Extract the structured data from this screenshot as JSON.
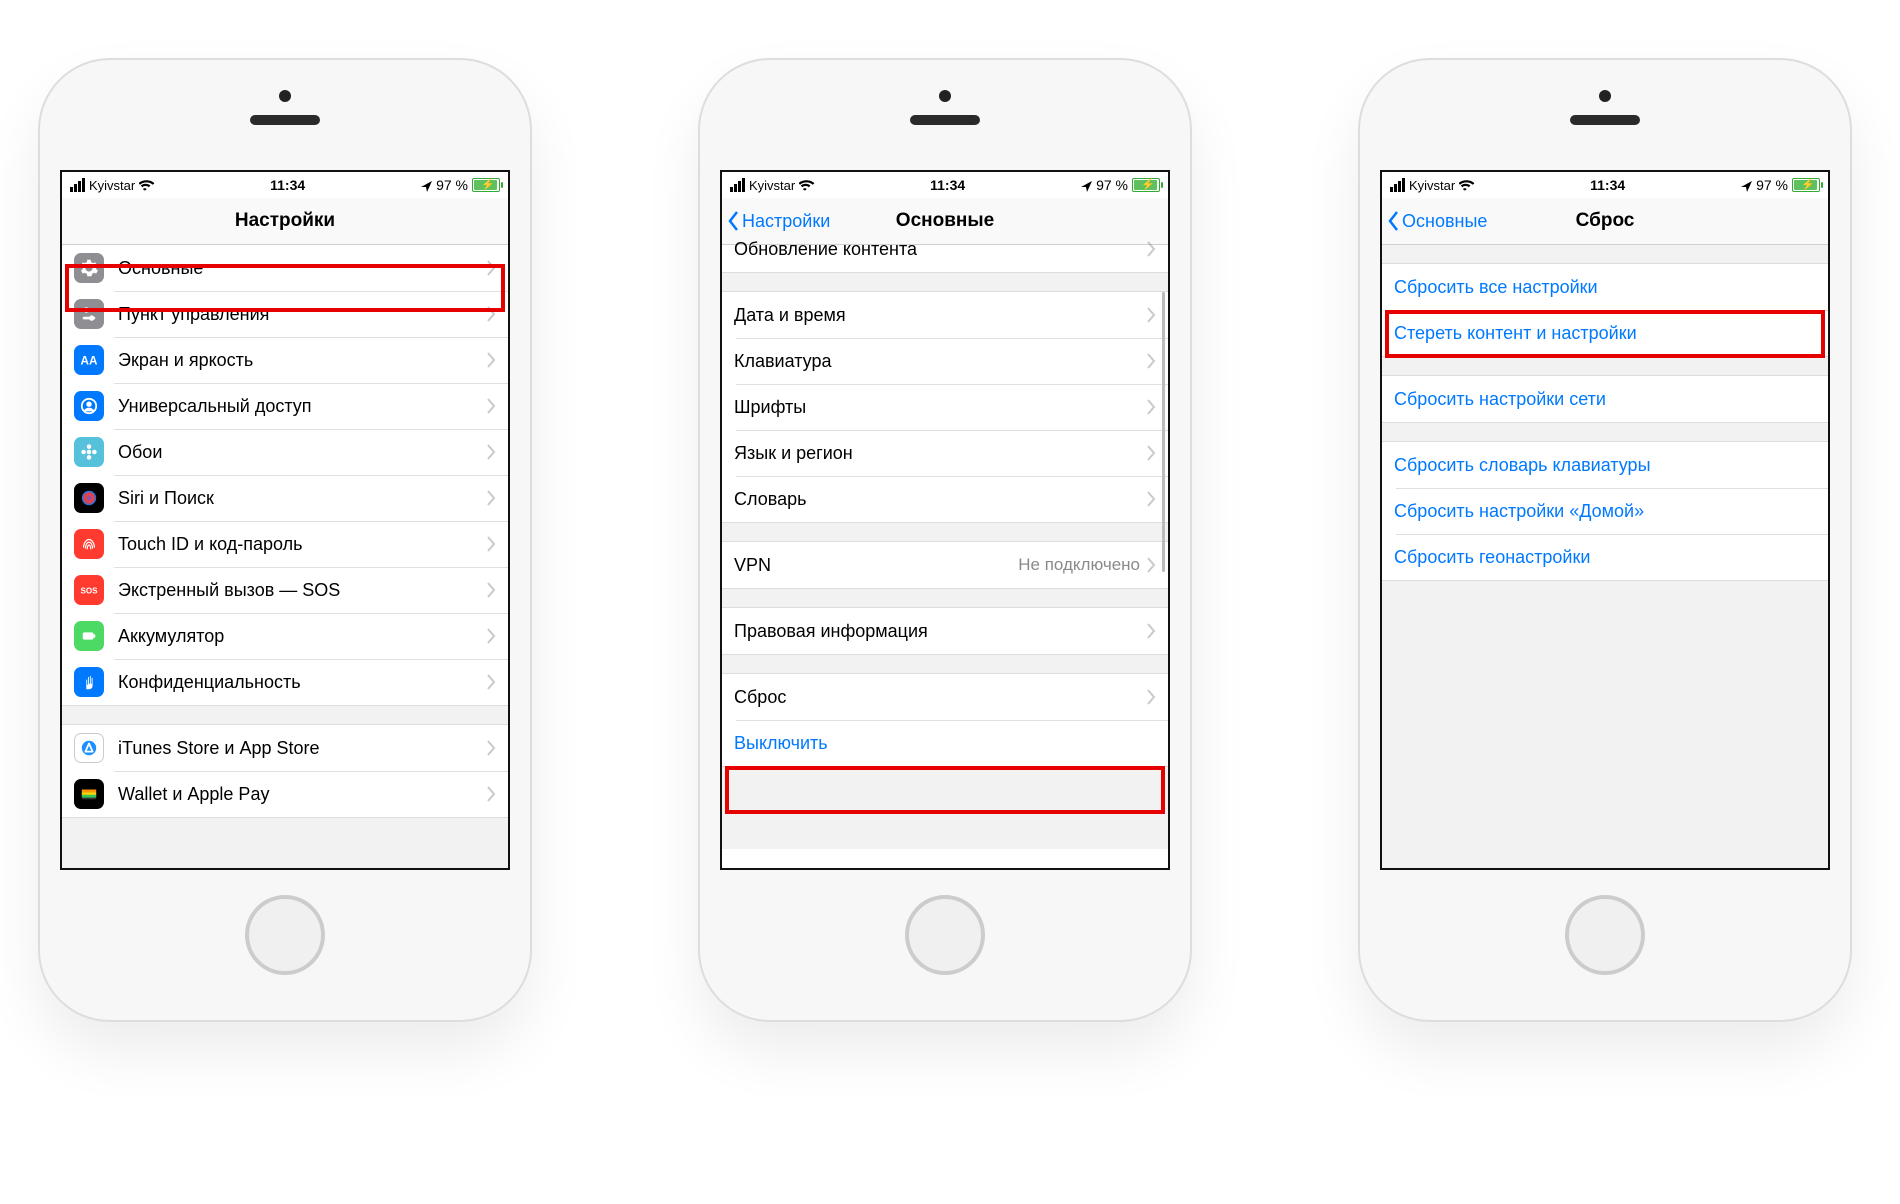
{
  "status": {
    "carrier": "Kyivstar",
    "time": "11:34",
    "battery": "97 %"
  },
  "phone1": {
    "title": "Настройки",
    "rows": [
      {
        "label": "Основные",
        "icon": "gear",
        "bg": "#8e8e93",
        "tint": "#fff"
      },
      {
        "label": "Пункт управления",
        "icon": "sliders",
        "bg": "#8e8e93",
        "tint": "#fff"
      },
      {
        "label": "Экран и яркость",
        "icon": "aa",
        "bg": "#0079ff",
        "tint": "#fff"
      },
      {
        "label": "Универсальный доступ",
        "icon": "person",
        "bg": "#0079ff",
        "tint": "#fff"
      },
      {
        "label": "Обои",
        "icon": "flower",
        "bg": "#55c1da",
        "tint": "#fff"
      },
      {
        "label": "Siri и Поиск",
        "icon": "siri",
        "bg": "#000",
        "tint": "#fff"
      },
      {
        "label": "Touch ID и код-пароль",
        "icon": "finger",
        "bg": "#ff3b30",
        "tint": "#fff"
      },
      {
        "label": "Экстренный вызов — SOS",
        "icon": "sos",
        "bg": "#ff3b30",
        "tint": "#fff"
      },
      {
        "label": "Аккумулятор",
        "icon": "batt",
        "bg": "#4cd964",
        "tint": "#fff"
      },
      {
        "label": "Конфиденциальность",
        "icon": "hand",
        "bg": "#0079ff",
        "tint": "#fff"
      }
    ],
    "rows2": [
      {
        "label": "iTunes Store и App Store",
        "icon": "appstore",
        "bg": "#fff",
        "tint": "#1e90ff",
        "border": true
      },
      {
        "label": "Wallet и Apple Pay",
        "icon": "wallet",
        "bg": "#000",
        "tint": "#fff"
      }
    ]
  },
  "phone2": {
    "back": "Настройки",
    "title": "Основные",
    "g1": [
      {
        "label": "Обновление контента"
      }
    ],
    "g2": [
      {
        "label": "Дата и время"
      },
      {
        "label": "Клавиатура"
      },
      {
        "label": "Шрифты"
      },
      {
        "label": "Язык и регион"
      },
      {
        "label": "Словарь"
      }
    ],
    "g3": [
      {
        "label": "VPN",
        "value": "Не подключено"
      }
    ],
    "g4": [
      {
        "label": "Правовая информация"
      }
    ],
    "g5": [
      {
        "label": "Сброс"
      },
      {
        "label": "Выключить",
        "blue": true,
        "nochev": true
      }
    ]
  },
  "phone3": {
    "back": "Основные",
    "title": "Сброс",
    "g1": [
      {
        "label": "Сбросить все настройки"
      },
      {
        "label": "Стереть контент и настройки"
      }
    ],
    "g2": [
      {
        "label": "Сбросить настройки сети"
      }
    ],
    "g3": [
      {
        "label": "Сбросить словарь клавиатуры"
      },
      {
        "label": "Сбросить настройки «Домой»"
      },
      {
        "label": "Сбросить геонастройки"
      }
    ]
  }
}
